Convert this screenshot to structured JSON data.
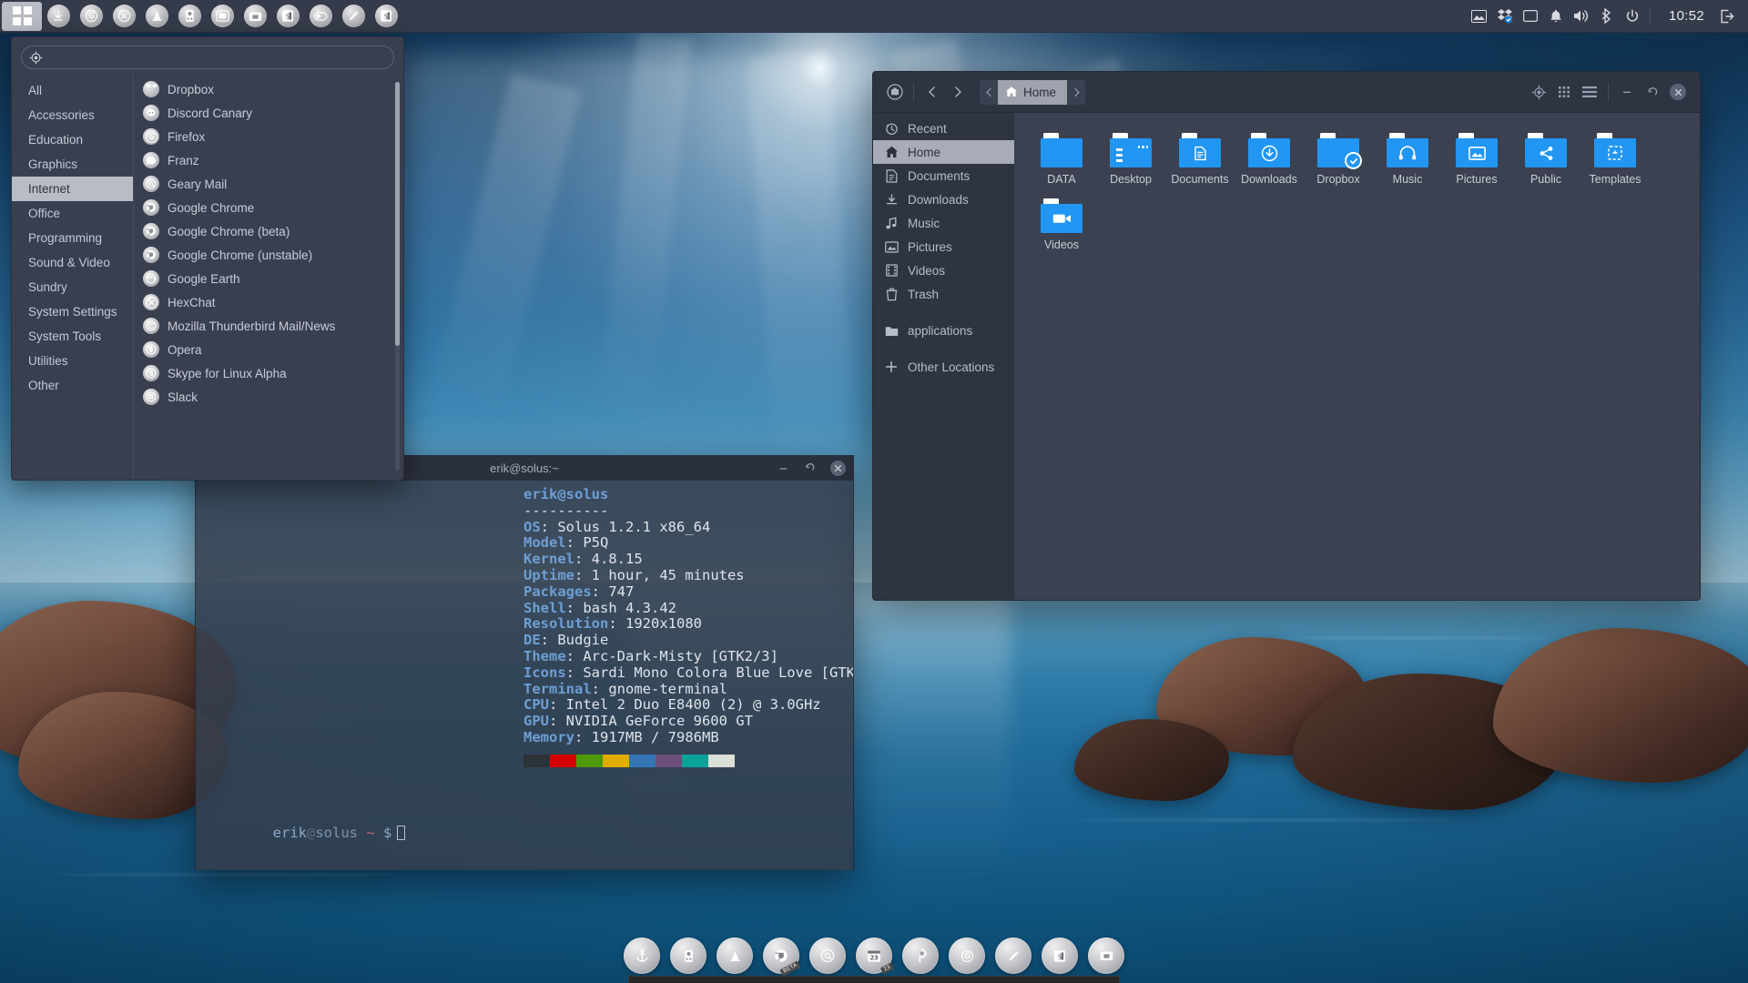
{
  "panel": {
    "launcher": {
      "name": "budgie-menu-launcher"
    },
    "icons": [
      {
        "name": "download-icon",
        "glyph": "download"
      },
      {
        "name": "firefox-icon",
        "glyph": "firefox"
      },
      {
        "name": "hexchat-icon",
        "glyph": "hexchat"
      },
      {
        "name": "traffic-cone-icon",
        "glyph": "cone"
      },
      {
        "name": "gps-icon",
        "glyph": "gps"
      },
      {
        "name": "image-viewer-icon",
        "glyph": "image"
      },
      {
        "name": "files-icon",
        "glyph": "files"
      },
      {
        "name": "terminal-dollar-icon",
        "glyph": "dollar"
      },
      {
        "name": "media-icon",
        "glyph": "media"
      },
      {
        "name": "editor-pencil-icon",
        "glyph": "pencil"
      },
      {
        "name": "second-dollar-icon",
        "glyph": "dollar"
      }
    ],
    "tray": [
      {
        "name": "display-icon",
        "glyph": "display"
      },
      {
        "name": "dropbox-tray-icon",
        "glyph": "dropbox"
      },
      {
        "name": "monitor-icon",
        "glyph": "monitor"
      },
      {
        "name": "notifications-bell-icon",
        "glyph": "bell"
      },
      {
        "name": "volume-icon",
        "glyph": "volume"
      },
      {
        "name": "bluetooth-icon",
        "glyph": "bluetooth"
      },
      {
        "name": "power-icon",
        "glyph": "power"
      }
    ],
    "clock": "10:52",
    "logout_icon": "logout-icon"
  },
  "app_menu": {
    "search": {
      "placeholder": "",
      "value": ""
    },
    "categories": [
      {
        "label": "All",
        "active": false
      },
      {
        "label": "Accessories",
        "active": false
      },
      {
        "label": "Education",
        "active": false
      },
      {
        "label": "Graphics",
        "active": false
      },
      {
        "label": "Internet",
        "active": true
      },
      {
        "label": "Office",
        "active": false
      },
      {
        "label": "Programming",
        "active": false
      },
      {
        "label": "Sound & Video",
        "active": false
      },
      {
        "label": "Sundry",
        "active": false
      },
      {
        "label": "System Settings",
        "active": false
      },
      {
        "label": "System Tools",
        "active": false
      },
      {
        "label": "Utilities",
        "active": false
      },
      {
        "label": "Other",
        "active": false
      }
    ],
    "apps": [
      {
        "label": "Dropbox",
        "icon": "dropbox-icon"
      },
      {
        "label": "Discord Canary",
        "icon": "discord-icon"
      },
      {
        "label": "Firefox",
        "icon": "firefox-icon"
      },
      {
        "label": "Franz",
        "icon": "franz-icon"
      },
      {
        "label": "Geary Mail",
        "icon": "geary-icon"
      },
      {
        "label": "Google Chrome",
        "icon": "chrome-icon"
      },
      {
        "label": "Google Chrome (beta)",
        "icon": "chrome-beta-icon"
      },
      {
        "label": "Google Chrome (unstable)",
        "icon": "chrome-unstable-icon"
      },
      {
        "label": "Google Earth",
        "icon": "google-earth-icon"
      },
      {
        "label": "HexChat",
        "icon": "hexchat-icon"
      },
      {
        "label": "Mozilla Thunderbird Mail/News",
        "icon": "thunderbird-icon"
      },
      {
        "label": "Opera",
        "icon": "opera-icon"
      },
      {
        "label": "Skype for Linux Alpha",
        "icon": "skype-icon"
      },
      {
        "label": "Slack",
        "icon": "slack-icon"
      }
    ]
  },
  "terminal": {
    "title": "erik@solus:~",
    "user_host": "erik@solus",
    "separator": "----------",
    "fetch": [
      {
        "key": "OS",
        "value": "Solus 1.2.1 x86_64"
      },
      {
        "key": "Model",
        "value": "P5Q"
      },
      {
        "key": "Kernel",
        "value": "4.8.15"
      },
      {
        "key": "Uptime",
        "value": "1 hour, 45 minutes"
      },
      {
        "key": "Packages",
        "value": "747"
      },
      {
        "key": "Shell",
        "value": "bash 4.3.42"
      },
      {
        "key": "Resolution",
        "value": "1920x1080"
      },
      {
        "key": "DE",
        "value": "Budgie"
      },
      {
        "key": "Theme",
        "value": "Arc-Dark-Misty [GTK2/3]"
      },
      {
        "key": "Icons",
        "value": "Sardi Mono Colora Blue Love [GTK"
      },
      {
        "key": "Terminal",
        "value": "gnome-terminal"
      },
      {
        "key": "CPU",
        "value": "Intel 2 Duo E8400 (2) @ 3.0GHz"
      },
      {
        "key": "GPU",
        "value": "NVIDIA GeForce 9600 GT"
      },
      {
        "key": "Memory",
        "value": "1917MB / 7986MB"
      }
    ],
    "palette": [
      "#2e3338",
      "#d40000",
      "#4e9a06",
      "#e0ac00",
      "#3575b5",
      "#6e4e7a",
      "#0aa39a",
      "#dcded8"
    ],
    "prompt": {
      "user": "erik",
      "at": "@",
      "host": "solus",
      "path": "~",
      "symbol": "$"
    },
    "buttons": {
      "minimize": "minimize-button",
      "maximize": "maximize-button",
      "close": "close-button"
    }
  },
  "file_manager": {
    "window_title": "Home",
    "toolbar": {
      "menu_icon": "app-menu-icon",
      "back_icon": "back-icon",
      "forward_icon": "forward-icon",
      "path_prev_icon": "path-prev-icon",
      "path_next_icon": "path-next-icon",
      "search_icon": "search-location-icon",
      "grid_view_icon": "grid-view-icon",
      "hamburger_icon": "hamburger-menu-icon",
      "minimize_icon": "minimize-icon",
      "restore_icon": "restore-icon",
      "close_icon": "close-icon"
    },
    "sidebar": [
      {
        "label": "Recent",
        "icon": "clock-icon",
        "active": false
      },
      {
        "label": "Home",
        "icon": "home-icon",
        "active": true
      },
      {
        "label": "Documents",
        "icon": "document-icon",
        "active": false
      },
      {
        "label": "Downloads",
        "icon": "download-icon",
        "active": false
      },
      {
        "label": "Music",
        "icon": "music-note-icon",
        "active": false
      },
      {
        "label": "Pictures",
        "icon": "picture-icon",
        "active": false
      },
      {
        "label": "Videos",
        "icon": "film-icon",
        "active": false
      },
      {
        "label": "Trash",
        "icon": "trash-icon",
        "active": false
      },
      {
        "label": "applications",
        "icon": "folder-icon",
        "active": false,
        "gap_before": true
      },
      {
        "label": "Other Locations",
        "icon": "plus-icon",
        "active": false,
        "gap_before": true
      }
    ],
    "folders": [
      {
        "label": "DATA",
        "emblem": "none"
      },
      {
        "label": "Desktop",
        "emblem": "desktop"
      },
      {
        "label": "Documents",
        "emblem": "document"
      },
      {
        "label": "Downloads",
        "emblem": "download"
      },
      {
        "label": "Dropbox",
        "emblem": "dropbox-check"
      },
      {
        "label": "Music",
        "emblem": "headphones"
      },
      {
        "label": "Pictures",
        "emblem": "picture"
      },
      {
        "label": "Public",
        "emblem": "share"
      },
      {
        "label": "Templates",
        "emblem": "template"
      },
      {
        "label": "Videos",
        "emblem": "video"
      }
    ]
  },
  "dock": {
    "icons": [
      {
        "name": "plank-anchor-icon",
        "glyph": "anchor",
        "badge": ""
      },
      {
        "name": "gps-locator-icon",
        "glyph": "gps",
        "badge": ""
      },
      {
        "name": "traffic-cone-icon",
        "glyph": "cone",
        "badge": ""
      },
      {
        "name": "chrome-beta-icon",
        "glyph": "chrome-beta",
        "badge": "BETA"
      },
      {
        "name": "geary-mail-icon",
        "glyph": "at",
        "badge": ""
      },
      {
        "name": "calendar-icon",
        "glyph": "calendar",
        "badge": "23"
      },
      {
        "name": "paint-icon",
        "glyph": "paint",
        "badge": ""
      },
      {
        "name": "firefox-icon",
        "glyph": "firefox",
        "badge": ""
      },
      {
        "name": "editor-pencil-icon",
        "glyph": "pencil",
        "badge": ""
      },
      {
        "name": "terminal-dollar-icon",
        "glyph": "dollar",
        "badge": ""
      },
      {
        "name": "files-icon",
        "glyph": "files",
        "badge": ""
      }
    ]
  }
}
